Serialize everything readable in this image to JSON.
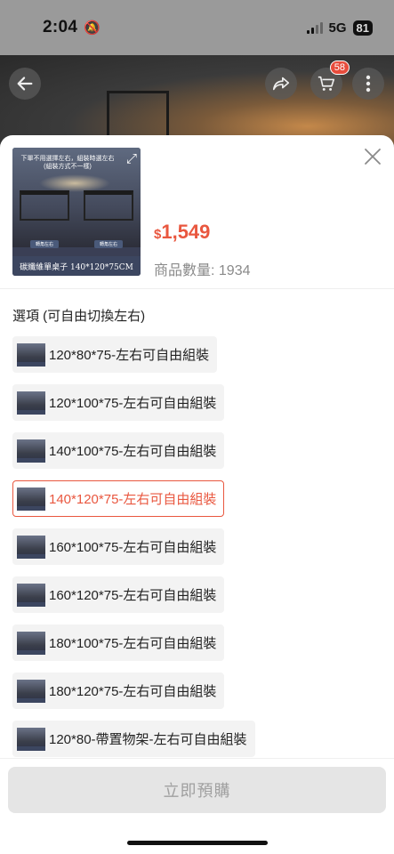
{
  "status_bar": {
    "time": "2:04",
    "network": "5G",
    "battery": "81"
  },
  "header": {
    "cart_count": "58"
  },
  "product": {
    "thumb_note": "下單不用選擇左右，組裝時選左右\n(組裝方式不一樣)",
    "thumb_buttons": [
      "轉角左右",
      "轉角左右"
    ],
    "thumb_caption": "碳纖維單桌子 140*120*75CM",
    "price_symbol": "$",
    "price_value": "1,549",
    "stock_text": "商品數量: 1934"
  },
  "options": {
    "title": "選項 (可自由切換左右)",
    "items": [
      {
        "label": "120*80*75-左右可自由組裝"
      },
      {
        "label": "120*100*75-左右可自由組裝"
      },
      {
        "label": "140*100*75-左右可自由組裝"
      },
      {
        "label": "140*120*75-左右可自由組裝"
      },
      {
        "label": "160*100*75-左右可自由組裝"
      },
      {
        "label": "160*120*75-左右可自由組裝"
      },
      {
        "label": "180*100*75-左右可自由組裝"
      },
      {
        "label": "180*120*75-左右可自由組裝"
      },
      {
        "label": "120*80-帶置物架-左右可自由組裝"
      }
    ],
    "selected_index": 3
  },
  "footer": {
    "button_label": "立即預購"
  },
  "colors": {
    "accent": "#e9573f",
    "disabled_button": "#e5e5e5"
  }
}
